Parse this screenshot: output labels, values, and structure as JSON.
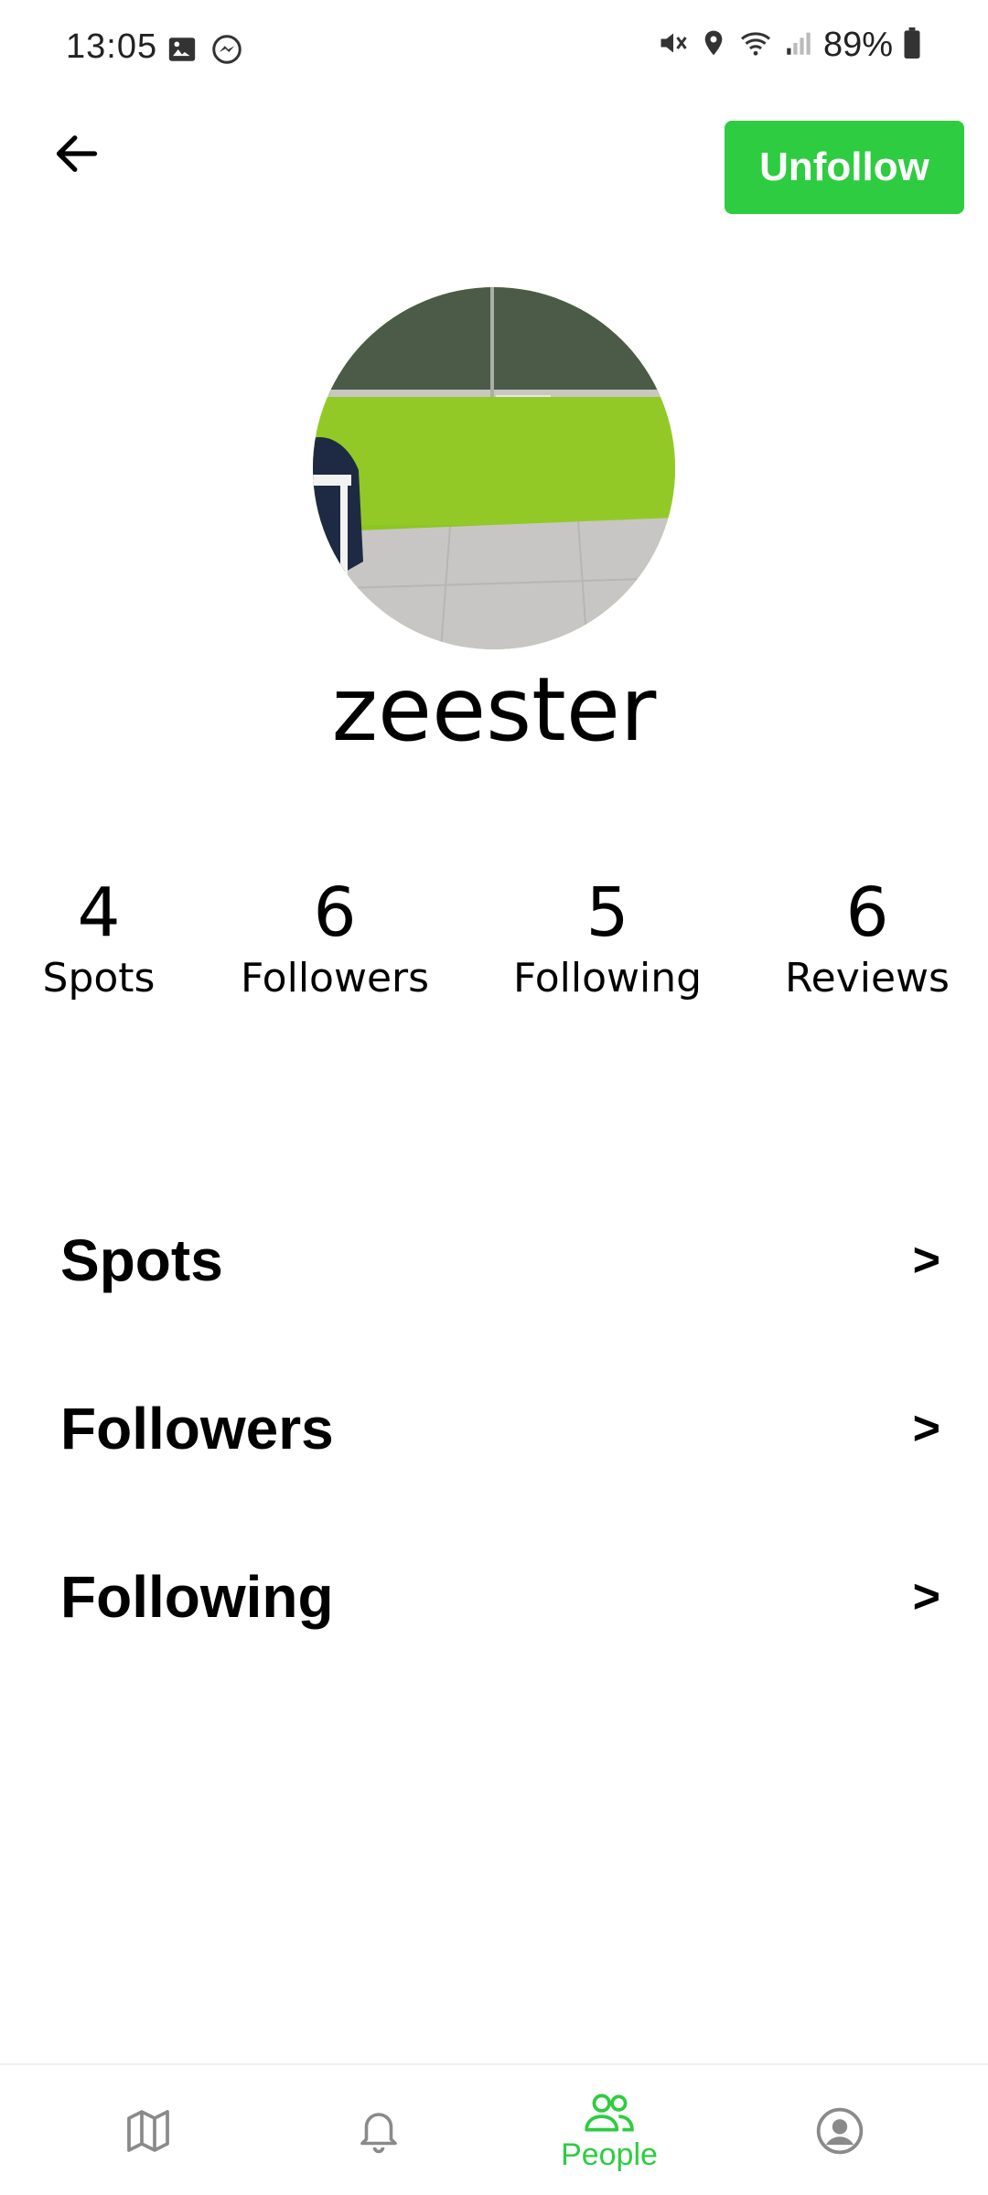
{
  "status_bar": {
    "time": "13:05",
    "battery": "89%",
    "icons": [
      "image-icon",
      "messenger-icon",
      "mute-icon",
      "location-icon",
      "wifi-icon",
      "signal-icon",
      "battery-icon"
    ]
  },
  "header": {
    "back_icon": "arrow-left-icon",
    "action_label": "Unfollow"
  },
  "profile": {
    "username": "zeester",
    "avatar": "photo-of-green-wall-classroom"
  },
  "stats": [
    {
      "count": "4",
      "label": "Spots"
    },
    {
      "count": "6",
      "label": "Followers"
    },
    {
      "count": "5",
      "label": "Following"
    },
    {
      "count": "6",
      "label": "Reviews"
    }
  ],
  "menu": [
    {
      "label": "Spots",
      "arrow": ">"
    },
    {
      "label": "Followers",
      "arrow": ">"
    },
    {
      "label": "Following",
      "arrow": ">"
    }
  ],
  "bottom_nav": {
    "items": [
      {
        "icon": "map-icon",
        "label": ""
      },
      {
        "icon": "bell-icon",
        "label": ""
      },
      {
        "icon": "people-icon",
        "label": "People",
        "active": true
      },
      {
        "icon": "account-icon",
        "label": ""
      }
    ]
  },
  "colors": {
    "accent": "#2ecc40",
    "inactive_icon": "#8a8a8a",
    "text": "#000000"
  }
}
